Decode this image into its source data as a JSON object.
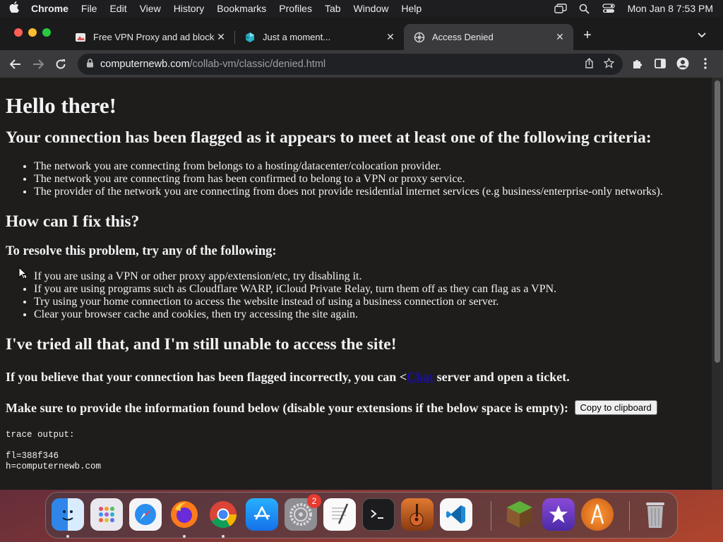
{
  "menubar": {
    "app_name": "Chrome",
    "items": [
      "File",
      "Edit",
      "View",
      "History",
      "Bookmarks",
      "Profiles",
      "Tab",
      "Window",
      "Help"
    ],
    "clock": "Mon Jan 8  7:53 PM"
  },
  "tabs": [
    {
      "title": "Free VPN Proxy and ad blocker",
      "active": false,
      "favicon": "vpn-favicon"
    },
    {
      "title": "Just a moment...",
      "active": false,
      "favicon": "cloudflare-favicon"
    },
    {
      "title": "Access Denied",
      "active": true,
      "favicon": "access-denied-favicon"
    }
  ],
  "address": {
    "host": "computernewb.com",
    "path": "/collab-vm/classic/denied.html"
  },
  "page": {
    "heading": "Hello there!",
    "criteria_heading": "Your connection has been flagged as it appears to meet at least one of the following criteria:",
    "criteria": [
      "The network you are connecting from belongs to a hosting/datacenter/colocation provider.",
      "The network you are connecting from has been confirmed to belong to a VPN or proxy service.",
      "The provider of the network you are connecting from does not provide residential internet services (e.g business/enterprise-only networks)."
    ],
    "fix_heading": "How can I fix this?",
    "resolve_heading": "To resolve this problem, try any of the following:",
    "fixes": [
      "If you are using a VPN or other proxy app/extension/etc, try disabling it.",
      "If you are using programs such as Cloudflare WARP, iCloud Private Relay, turn them off as they can flag as a VPN.",
      "Try using your home connection to access the website instead of using a business connection or server.",
      "Clear your browser cache and cookies, then try accessing the site again."
    ],
    "still_heading": "I've tried all that, and I'm still unable to access the site!",
    "flagged_prefix": "If you believe that your connection has been flagged incorrectly, you can <",
    "flagged_link": "Chat",
    "flagged_suffix": " server and open a ticket.",
    "info_text": "Make sure to provide the information found below (disable your extensions if the below space is empty): ",
    "copy_button": "Copy to clipboard",
    "trace_label": "trace output:",
    "trace_lines": [
      "fl=388f346",
      "h=computernewb.com"
    ]
  },
  "dock": {
    "apps": [
      "Finder",
      "Launchpad",
      "Safari",
      "Firefox",
      "Chrome",
      "App Store",
      "System Settings",
      "TextEdit",
      "Terminal",
      "GarageBand",
      "Visual Studio Code",
      "Minecraft",
      "iMovie",
      "Instruments",
      "Trash"
    ],
    "settings_badge": "2"
  }
}
